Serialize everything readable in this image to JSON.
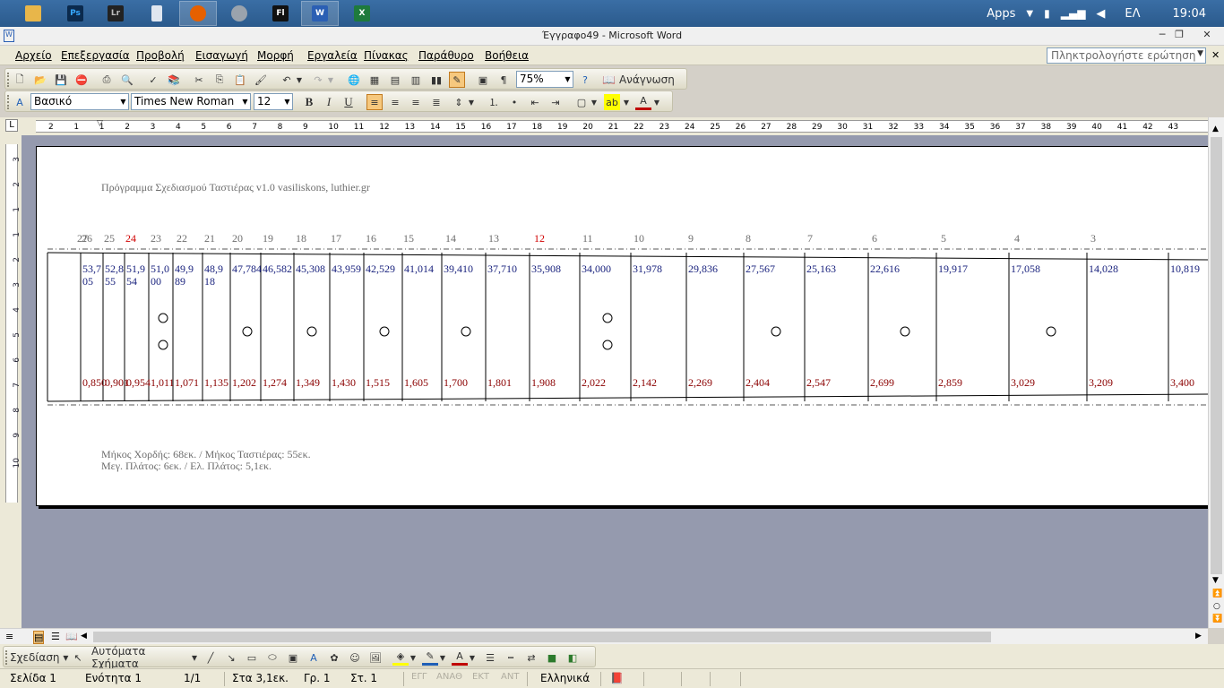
{
  "taskbar": {
    "apps": [
      {
        "name": "file-explorer",
        "label": ""
      },
      {
        "name": "photoshop",
        "label": "Ps"
      },
      {
        "name": "lightroom",
        "label": "Lr"
      },
      {
        "name": "calculator",
        "label": ""
      },
      {
        "name": "firefox",
        "label": ""
      },
      {
        "name": "settings",
        "label": ""
      },
      {
        "name": "flash",
        "label": "Fl"
      },
      {
        "name": "word",
        "label": "W"
      },
      {
        "name": "excel",
        "label": "X"
      }
    ],
    "apps_label": "Apps",
    "language": "ΕΛ",
    "time": "19:04"
  },
  "window": {
    "title": "Έγγραφο49 - Microsoft Word"
  },
  "menu": {
    "items": [
      "Αρχείο",
      "Επεξεργασία",
      "Προβολή",
      "Εισαγωγή",
      "Μορφή",
      "Εργαλεία",
      "Πίνακας",
      "Παράθυρο",
      "Βοήθεια"
    ],
    "help_placeholder": "Πληκτρολογήστε ερώτηση"
  },
  "standard_toolbar": {
    "zoom": "75%",
    "reading_label": "Ανάγνωση"
  },
  "format_toolbar": {
    "style": "Βασικό",
    "font": "Times New Roman",
    "size": "12",
    "bold": "B",
    "italic": "I",
    "underline": "U"
  },
  "ruler": {
    "marks": [
      "2",
      "1",
      "1",
      "2",
      "3",
      "4",
      "5",
      "6",
      "7",
      "8",
      "9",
      "10",
      "11",
      "12",
      "13",
      "14",
      "15",
      "16",
      "17",
      "18",
      "19",
      "20",
      "21",
      "22",
      "23",
      "24",
      "25",
      "26",
      "27",
      "28",
      "29",
      "30",
      "31",
      "32",
      "33",
      "34",
      "35",
      "36",
      "37",
      "38",
      "39",
      "40",
      "41",
      "42",
      "43"
    ]
  },
  "vruler": {
    "marks": [
      "3",
      "2",
      "1",
      "1",
      "2",
      "3",
      "4",
      "5",
      "6",
      "7",
      "8",
      "9",
      "10"
    ]
  },
  "document": {
    "header": "Πρόγραμμα Σχεδιασμού Ταστιέρας  v1.0    vasiliskons, luthier.gr",
    "frets": [
      {
        "num": "27",
        "top": "",
        "bottom": "",
        "red": false
      },
      {
        "num": "26",
        "top": "53,705",
        "bottom": "0,850",
        "red": false
      },
      {
        "num": "25",
        "top": "52,855",
        "bottom": "0,901",
        "red": false
      },
      {
        "num": "24",
        "top": "51,954",
        "bottom": "0,954",
        "red": true
      },
      {
        "num": "23",
        "top": "51,000",
        "bottom": "1,011",
        "red": false
      },
      {
        "num": "22",
        "top": "49,989",
        "bottom": "1,071",
        "red": false
      },
      {
        "num": "21",
        "top": "48,918",
        "bottom": "1,135",
        "red": false
      },
      {
        "num": "20",
        "top": "47,784",
        "bottom": "1,202",
        "red": false
      },
      {
        "num": "19",
        "top": "46,582",
        "bottom": "1,274",
        "red": false
      },
      {
        "num": "18",
        "top": "45,308",
        "bottom": "1,349",
        "red": false
      },
      {
        "num": "17",
        "top": "43,959",
        "bottom": "1,430",
        "red": false
      },
      {
        "num": "16",
        "top": "42,529",
        "bottom": "1,515",
        "red": false
      },
      {
        "num": "15",
        "top": "41,014",
        "bottom": "1,605",
        "red": false
      },
      {
        "num": "14",
        "top": "39,410",
        "bottom": "1,700",
        "red": false
      },
      {
        "num": "13",
        "top": "37,710",
        "bottom": "1,801",
        "red": false
      },
      {
        "num": "12",
        "top": "35,908",
        "bottom": "1,908",
        "red": true
      },
      {
        "num": "11",
        "top": "34,000",
        "bottom": "2,022",
        "red": false
      },
      {
        "num": "10",
        "top": "31,978",
        "bottom": "2,142",
        "red": false
      },
      {
        "num": "9",
        "top": "29,836",
        "bottom": "2,269",
        "red": false
      },
      {
        "num": "8",
        "top": "27,567",
        "bottom": "2,404",
        "red": false
      },
      {
        "num": "7",
        "top": "25,163",
        "bottom": "2,547",
        "red": false
      },
      {
        "num": "6",
        "top": "22,616",
        "bottom": "2,699",
        "red": false
      },
      {
        "num": "5",
        "top": "19,917",
        "bottom": "2,859",
        "red": false
      },
      {
        "num": "4",
        "top": "17,058",
        "bottom": "3,029",
        "red": false
      },
      {
        "num": "3",
        "top": "14,028",
        "bottom": "3,209",
        "red": false
      },
      {
        "num": "",
        "top": "10,819",
        "bottom": "3,400",
        "red": false
      }
    ],
    "footer_line1": "Μήκος Χορδής: 68εκ. / Μήκος Ταστιέρας: 55εκ.",
    "footer_line2": "Μεγ. Πλάτος: 6εκ. / Ελ. Πλάτος: 5,1εκ."
  },
  "drawing_toolbar": {
    "draw_label": "Σχεδίαση",
    "autoshapes_label": "Αυτόματα Σχήματα"
  },
  "statusbar": {
    "page": "Σελίδα  1",
    "section": "Ενότητα  1",
    "pages": "1/1",
    "at": "Στα  3,1εκ.",
    "line": "Γρ.  1",
    "col": "Στ.  1",
    "rec": "ΕΓΓ",
    "trk": "ΑΝΑΘ",
    "ext": "ΕΚΤ",
    "ovr": "ΑΝΤ",
    "lang": "Ελληνικά"
  }
}
